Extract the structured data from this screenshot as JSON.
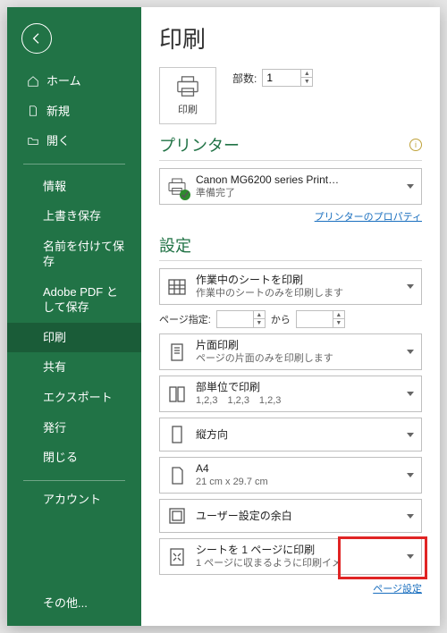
{
  "sidebar": {
    "top": [
      {
        "label": "ホーム",
        "icon": "home"
      },
      {
        "label": "新規",
        "icon": "file"
      },
      {
        "label": "開く",
        "icon": "folder"
      }
    ],
    "mid": [
      {
        "label": "情報"
      },
      {
        "label": "上書き保存"
      },
      {
        "label": "名前を付けて保存"
      },
      {
        "label": "Adobe PDF として保存"
      },
      {
        "label": "印刷",
        "active": true
      },
      {
        "label": "共有"
      },
      {
        "label": "エクスポート"
      },
      {
        "label": "発行"
      },
      {
        "label": "閉じる"
      }
    ],
    "bottom": [
      {
        "label": "アカウント"
      },
      {
        "label": "その他..."
      }
    ]
  },
  "page_title": "印刷",
  "print_button_label": "印刷",
  "copies_label": "部数:",
  "copies_value": "1",
  "printer_section": "プリンター",
  "printer_name": "Canon MG6200 series Print…",
  "printer_status": "準備完了",
  "printer_props_link": "プリンターのプロパティ",
  "settings_section": "設定",
  "opt_sheet_t1": "作業中のシートを印刷",
  "opt_sheet_t2": "作業中のシートのみを印刷します",
  "pages_label": "ページ指定:",
  "pages_from": "",
  "pages_sep": "から",
  "pages_to": "",
  "opt_side_t1": "片面印刷",
  "opt_side_t2": "ページの片面のみを印刷します",
  "opt_collate_t1": "部単位で印刷",
  "opt_collate_t2": "1,2,3　1,2,3　1,2,3",
  "opt_orient": "縦方向",
  "opt_size_t1": "A4",
  "opt_size_t2": "21 cm x 29.7 cm",
  "opt_margin": "ユーザー設定の余白",
  "opt_scale_t1": "シートを 1 ページに印刷",
  "opt_scale_t2": "1 ページに収まるように印刷イメ",
  "page_setup_link": "ページ設定"
}
